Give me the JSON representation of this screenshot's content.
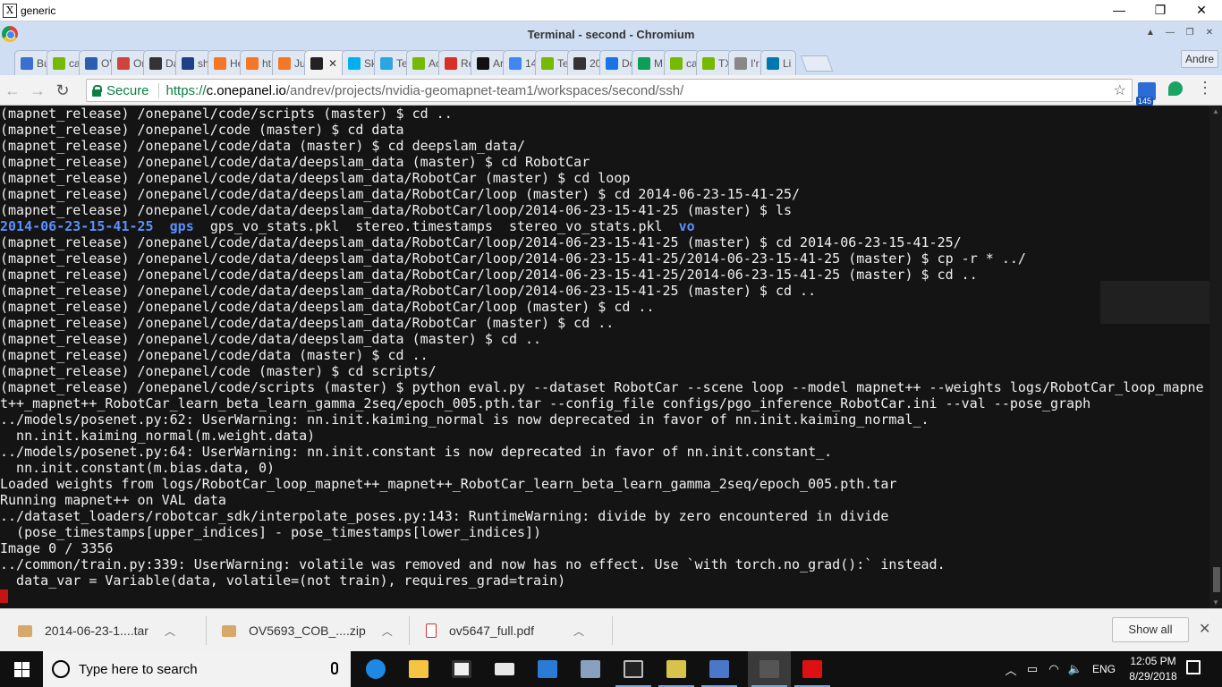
{
  "xwindow": {
    "title": "generic",
    "min": "—",
    "restore": "❐",
    "close": "✕"
  },
  "chrome": {
    "window_title": "Terminal - second - Chromium",
    "profile_name": "Andre",
    "tabs": [
      {
        "label": "Bu",
        "icon": "blue-grid-icon",
        "color": "#3b6fd0"
      },
      {
        "label": "ca",
        "icon": "nvidia-icon",
        "color": "#76b900"
      },
      {
        "label": "OV",
        "icon": "ov-icon",
        "color": "#2a5db0"
      },
      {
        "label": "Or",
        "icon": "grid-icon",
        "color": "#d0453b"
      },
      {
        "label": "Da",
        "icon": "page-icon",
        "color": "#333333"
      },
      {
        "label": "sh",
        "icon": "u-icon",
        "color": "#1f3f8a"
      },
      {
        "label": "He",
        "icon": "jupyter-icon",
        "color": "#f37726"
      },
      {
        "label": "ht",
        "icon": "terminal-arrow-icon",
        "color": "#f37726"
      },
      {
        "label": "Ju",
        "icon": "jupyter-icon",
        "color": "#f37726"
      },
      {
        "label": "",
        "icon": "terminal-icon",
        "color": "#222222",
        "active": true
      },
      {
        "label": "Sk",
        "icon": "skype-icon",
        "color": "#00aff0"
      },
      {
        "label": "Te",
        "icon": "telegram-icon",
        "color": "#2ca5e0"
      },
      {
        "label": "Ac",
        "icon": "nvidia-icon",
        "color": "#76b900"
      },
      {
        "label": "Re",
        "icon": "gmail-icon",
        "color": "#d93025"
      },
      {
        "label": "Ar",
        "icon": "github-icon",
        "color": "#111111"
      },
      {
        "label": "14",
        "icon": "google-icon",
        "color": "#4285f4"
      },
      {
        "label": "Te",
        "icon": "nvidia-icon",
        "color": "#76b900"
      },
      {
        "label": "20",
        "icon": "page-icon",
        "color": "#333333"
      },
      {
        "label": "Dc",
        "icon": "download-icon",
        "color": "#1a73e8"
      },
      {
        "label": "M",
        "icon": "drive-icon",
        "color": "#0f9d58"
      },
      {
        "label": "ca",
        "icon": "nvidia-icon",
        "color": "#76b900"
      },
      {
        "label": "TX",
        "icon": "nvidia-icon",
        "color": "#76b900"
      },
      {
        "label": "I'r",
        "icon": "doc-icon",
        "color": "#888888"
      },
      {
        "label": "Li",
        "icon": "linkedin-icon",
        "color": "#0077b5"
      }
    ],
    "tab_close": "✕"
  },
  "toolbar": {
    "back": "←",
    "forward": "→",
    "reload": "↻",
    "secure_label": "Secure",
    "url_scheme": "https://",
    "url_host": "c.onepanel.io",
    "url_path": "/andrev/projects/nvidia-geomapnet-team1/workspaces/second/ssh/",
    "star": "☆",
    "ext_badge": "145",
    "menu": "⋮"
  },
  "terminal": {
    "lines": [
      "(mapnet_release) /onepanel/code/scripts (master) $ cd ..",
      "(mapnet_release) /onepanel/code (master) $ cd data",
      "(mapnet_release) /onepanel/code/data (master) $ cd deepslam_data/",
      "(mapnet_release) /onepanel/code/data/deepslam_data (master) $ cd RobotCar",
      "(mapnet_release) /onepanel/code/data/deepslam_data/RobotCar (master) $ cd loop",
      "(mapnet_release) /onepanel/code/data/deepslam_data/RobotCar/loop (master) $ cd 2014-06-23-15-41-25/",
      "(mapnet_release) /onepanel/code/data/deepslam_data/RobotCar/loop/2014-06-23-15-41-25 (master) $ ls",
      "",
      "(mapnet_release) /onepanel/code/data/deepslam_data/RobotCar/loop/2014-06-23-15-41-25 (master) $ cd 2014-06-23-15-41-25/",
      "(mapnet_release) /onepanel/code/data/deepslam_data/RobotCar/loop/2014-06-23-15-41-25/2014-06-23-15-41-25 (master) $ cp -r * ../",
      "(mapnet_release) /onepanel/code/data/deepslam_data/RobotCar/loop/2014-06-23-15-41-25/2014-06-23-15-41-25 (master) $ cd ..",
      "(mapnet_release) /onepanel/code/data/deepslam_data/RobotCar/loop/2014-06-23-15-41-25 (master) $ cd ..",
      "(mapnet_release) /onepanel/code/data/deepslam_data/RobotCar/loop (master) $ cd ..",
      "(mapnet_release) /onepanel/code/data/deepslam_data/RobotCar (master) $ cd ..",
      "(mapnet_release) /onepanel/code/data/deepslam_data (master) $ cd ..",
      "(mapnet_release) /onepanel/code/data (master) $ cd ..",
      "(mapnet_release) /onepanel/code (master) $ cd scripts/",
      "(mapnet_release) /onepanel/code/scripts (master) $ python eval.py --dataset RobotCar --scene loop --model mapnet++ --weights logs/RobotCar_loop_mapne",
      "t++_mapnet++_RobotCar_learn_beta_learn_gamma_2seq/epoch_005.pth.tar --config_file configs/pgo_inference_RobotCar.ini --val --pose_graph",
      "../models/posenet.py:62: UserWarning: nn.init.kaiming_normal is now deprecated in favor of nn.init.kaiming_normal_.",
      "  nn.init.kaiming_normal(m.weight.data)",
      "../models/posenet.py:64: UserWarning: nn.init.constant is now deprecated in favor of nn.init.constant_.",
      "  nn.init.constant(m.bias.data, 0)",
      "Loaded weights from logs/RobotCar_loop_mapnet++_mapnet++_RobotCar_learn_beta_learn_gamma_2seq/epoch_005.pth.tar",
      "Running mapnet++ on VAL data",
      "../dataset_loaders/robotcar_sdk/interpolate_poses.py:143: RuntimeWarning: divide by zero encountered in divide",
      "  (pose_timestamps[upper_indices] - pose_timestamps[lower_indices])",
      "Image 0 / 3356",
      "../common/train.py:339: UserWarning: volatile was removed and now has no effect. Use `with torch.no_grad():` instead.",
      "  data_var = Variable(data, volatile=(not train), requires_grad=train)"
    ],
    "ls_output": {
      "dirs": [
        "2014-06-23-15-41-25",
        "gps"
      ],
      "files": [
        "gps_vo_stats.pkl",
        "stereo.timestamps",
        "stereo_vo_stats.pkl"
      ],
      "trailing_dir": "vo"
    },
    "dir_color": "#5b8fff"
  },
  "downloads": {
    "items": [
      {
        "name": "2014-06-23-1....tar",
        "type": "archive"
      },
      {
        "name": "OV5693_COB_....zip",
        "type": "archive"
      },
      {
        "name": "ov5647_full.pdf",
        "type": "pdf"
      }
    ],
    "show_all": "Show all",
    "close": "✕",
    "chevron": "︿"
  },
  "taskbar": {
    "search_placeholder": "Type here to search",
    "language": "ENG",
    "time": "12:05 PM",
    "date": "8/29/2018"
  }
}
